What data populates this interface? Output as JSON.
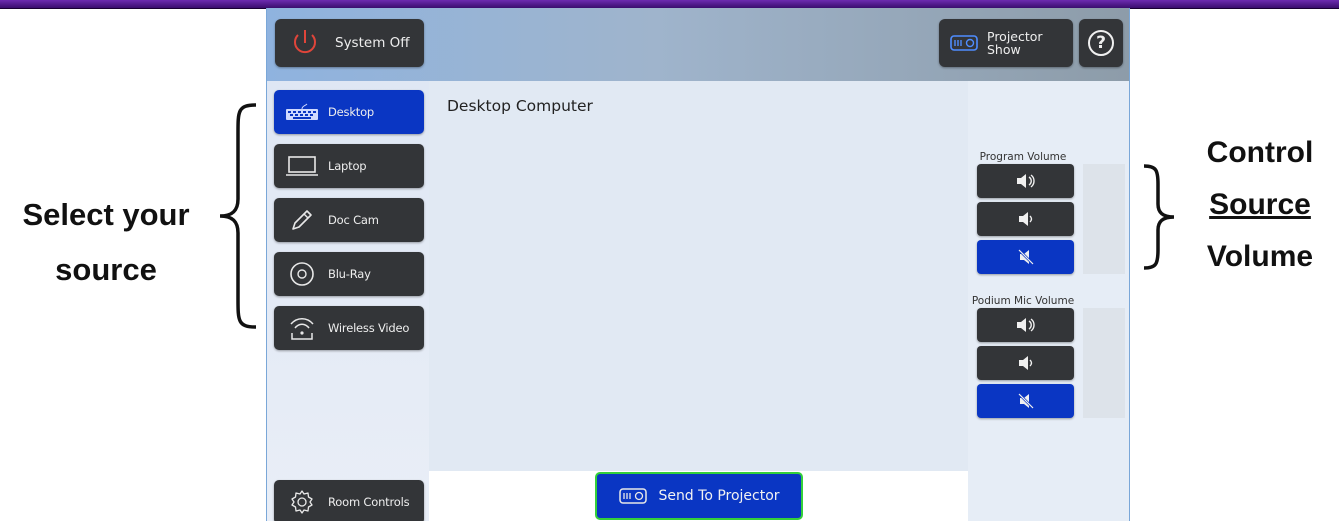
{
  "header": {
    "system_off_label": "System Off",
    "projector_show_line1": "Projector",
    "projector_show_line2": "Show",
    "help_label": "?"
  },
  "sources": [
    {
      "label": "Desktop",
      "icon": "keyboard-icon",
      "active": true
    },
    {
      "label": "Laptop",
      "icon": "laptop-icon",
      "active": false
    },
    {
      "label": "Doc Cam",
      "icon": "pen-icon",
      "active": false
    },
    {
      "label": "Blu-Ray",
      "icon": "disc-icon",
      "active": false
    },
    {
      "label": "Wireless Video",
      "icon": "wireless-icon",
      "active": false
    }
  ],
  "room_controls_label": "Room Controls",
  "center": {
    "title": "Desktop Computer",
    "send_label": "Send To Projector"
  },
  "volume": {
    "program_label": "Program Volume",
    "podium_label": "Podium Mic Volume"
  },
  "annotations": {
    "left_line1": "Select your",
    "left_line2": "source",
    "right_line1": "Control",
    "right_line2": "Source",
    "right_line3": "Volume"
  },
  "colors": {
    "accent_blue": "#0a36c3",
    "dark_button": "#333538",
    "send_border": "#34d03a",
    "power_red": "#e0453a"
  }
}
